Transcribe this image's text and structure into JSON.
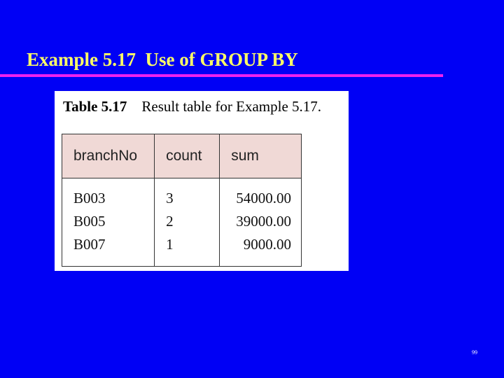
{
  "slide": {
    "title": "Example 5.17  Use of GROUP BY",
    "page_number": "99",
    "colors": {
      "background": "#0000f5",
      "title_text": "#ffff66",
      "title_rule": "#ee22ee",
      "table_header_bg": "#f0d9d6"
    }
  },
  "figure": {
    "caption_number": "Table 5.17",
    "caption_text": "Result table for Example 5.17.",
    "table": {
      "columns": [
        "branchNo",
        "count",
        "sum"
      ],
      "rows": [
        [
          "B003",
          "3",
          "54000.00"
        ],
        [
          "B005",
          "2",
          "39000.00"
        ],
        [
          "B007",
          "1",
          "9000.00"
        ]
      ]
    }
  }
}
